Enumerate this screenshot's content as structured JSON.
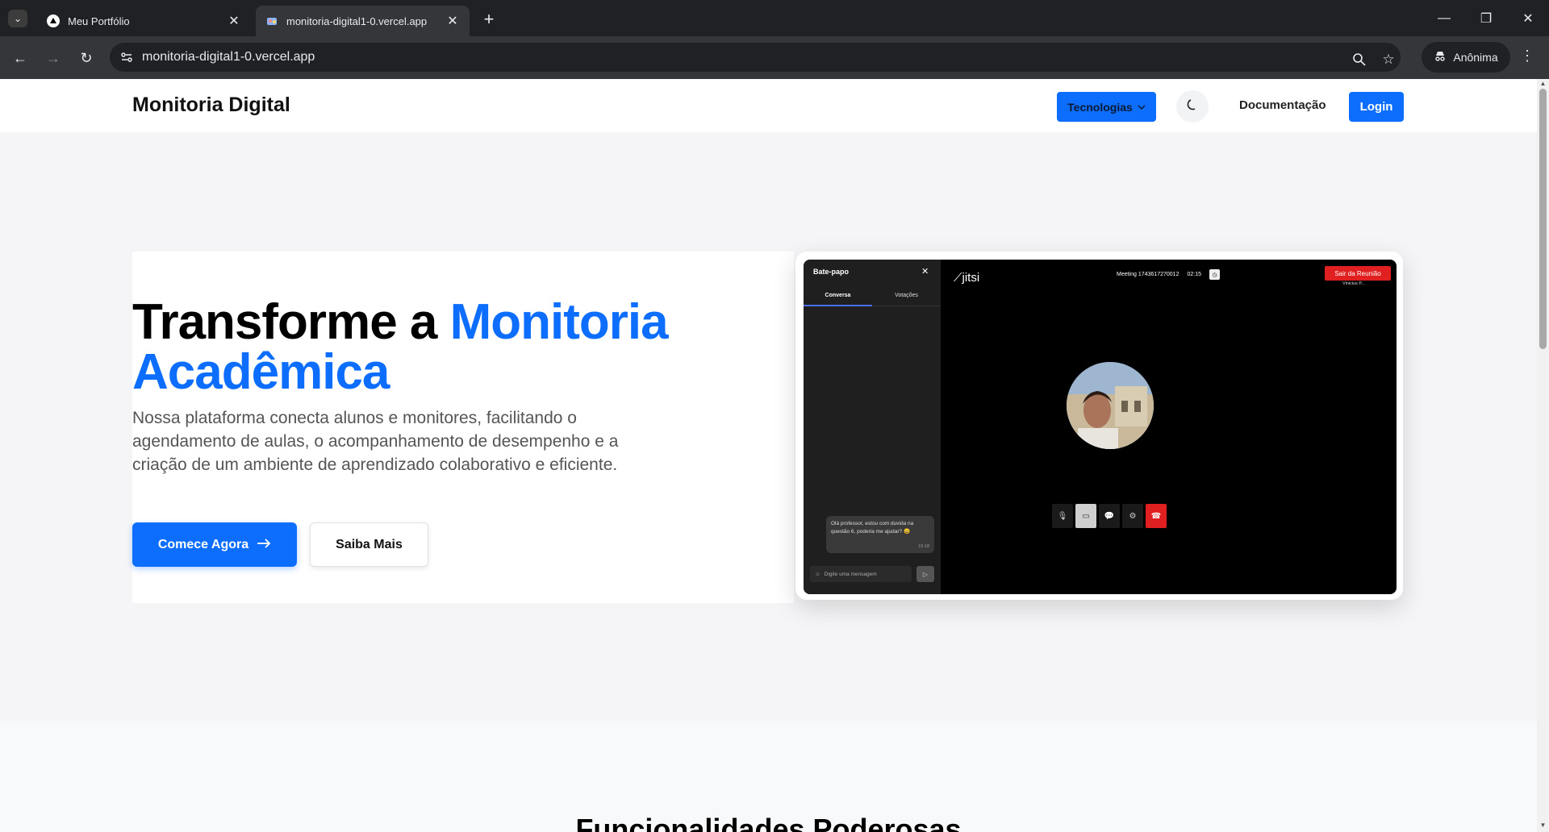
{
  "browser": {
    "tabs": [
      {
        "title": "Meu Portfólio",
        "active": false
      },
      {
        "title": "monitoria-digital1-0.vercel.app",
        "active": true
      }
    ],
    "url": "monitoria-digital1-0.vercel.app",
    "profile_label": "Anônima"
  },
  "nav": {
    "brand": "Monitoria Digital",
    "tech_label": "Tecnologias",
    "docs_label": "Documentação",
    "login_label": "Login"
  },
  "hero": {
    "headline_part1": "Transforme a ",
    "headline_blue1": "Monitoria",
    "headline_blue2": "Acadêmica",
    "subtext": "Nossa plataforma conecta alunos e monitores, facilitando o agendamento de aulas, o acompanhamento de desempenho e a criação de um ambiente de aprendizado colaborativo e eficiente.",
    "primary_cta": "Comece Agora",
    "secondary_cta": "Saiba Mais"
  },
  "mockup": {
    "chat_title": "Bate-papo",
    "chat_tabs": [
      "Conversa",
      "Votações"
    ],
    "message": "Olá professor, estou com duvida na questão 6, poderia me ajudar? 😄",
    "message_time": "15:18",
    "input_placeholder": "Digite uma mensagem",
    "logo_text": "jitsi",
    "meeting_name": "Meeting 1743617270012",
    "meeting_time": "02:15",
    "leave_label": "Sair da Reunião",
    "participant_name": "Vinicius P..."
  },
  "section": {
    "features_title": "Funcionalidades Poderosas"
  },
  "colors": {
    "accent": "#0d6efd",
    "hangup": "#e02020"
  }
}
